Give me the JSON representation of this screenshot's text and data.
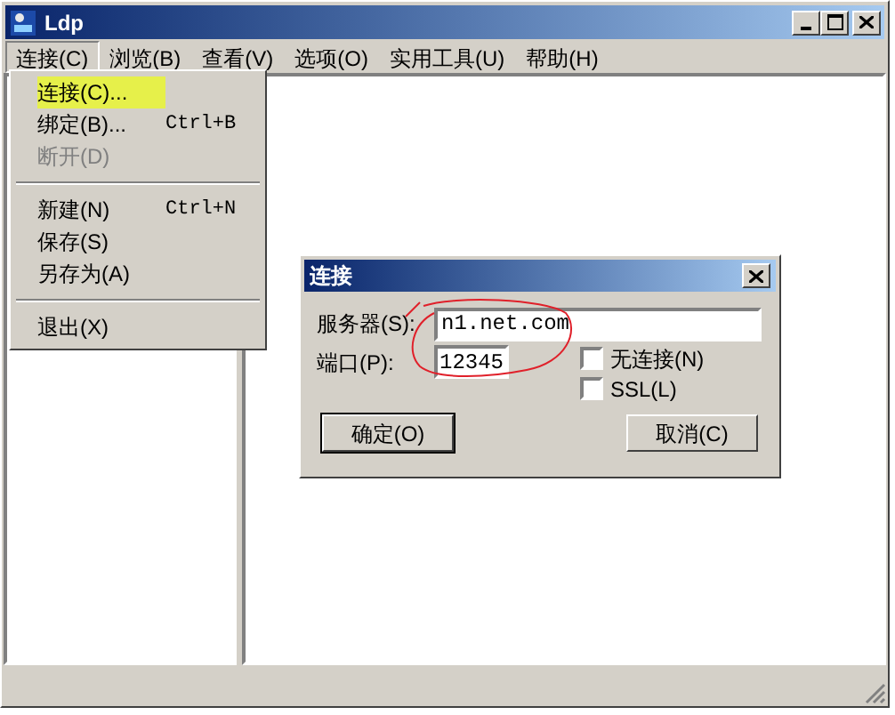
{
  "window": {
    "title": "Ldp"
  },
  "menu_bar": [
    {
      "label": "连接(C)",
      "selected": true
    },
    {
      "label": "浏览(B)",
      "selected": false
    },
    {
      "label": "查看(V)",
      "selected": false
    },
    {
      "label": "选项(O)",
      "selected": false
    },
    {
      "label": "实用工具(U)",
      "selected": false
    },
    {
      "label": "帮助(H)",
      "selected": false
    }
  ],
  "menu": [
    {
      "kind": "item",
      "label": "连接(C)...",
      "disabled": false,
      "highlighted": true
    },
    {
      "kind": "item",
      "label": "绑定(B)...",
      "shortcut": "Ctrl+B",
      "disabled": false,
      "highlighted": false
    },
    {
      "kind": "item",
      "label": "断开(D)",
      "disabled": true,
      "highlighted": false
    },
    {
      "kind": "separator"
    },
    {
      "kind": "item",
      "label": "新建(N)",
      "shortcut": "Ctrl+N",
      "disabled": false,
      "highlighted": false
    },
    {
      "kind": "item",
      "label": "保存(S)",
      "disabled": false,
      "highlighted": false
    },
    {
      "kind": "item",
      "label": "另存为(A)",
      "disabled": false,
      "highlighted": false
    },
    {
      "kind": "separator"
    },
    {
      "kind": "item",
      "label": "退出(X)",
      "disabled": false,
      "highlighted": false
    }
  ],
  "dialog": {
    "title": "连接",
    "server_label": "服务器(S):",
    "server_value": "n1.net.com",
    "port_label": "端口(P):",
    "port_value": "12345",
    "checkboxes": [
      {
        "label": "无连接(N)",
        "checked": false
      },
      {
        "label": "SSL(L)",
        "checked": false
      }
    ],
    "buttons": [
      {
        "label": "确定(O)",
        "default": true
      },
      {
        "label": "取消(C)",
        "default": false
      }
    ]
  }
}
